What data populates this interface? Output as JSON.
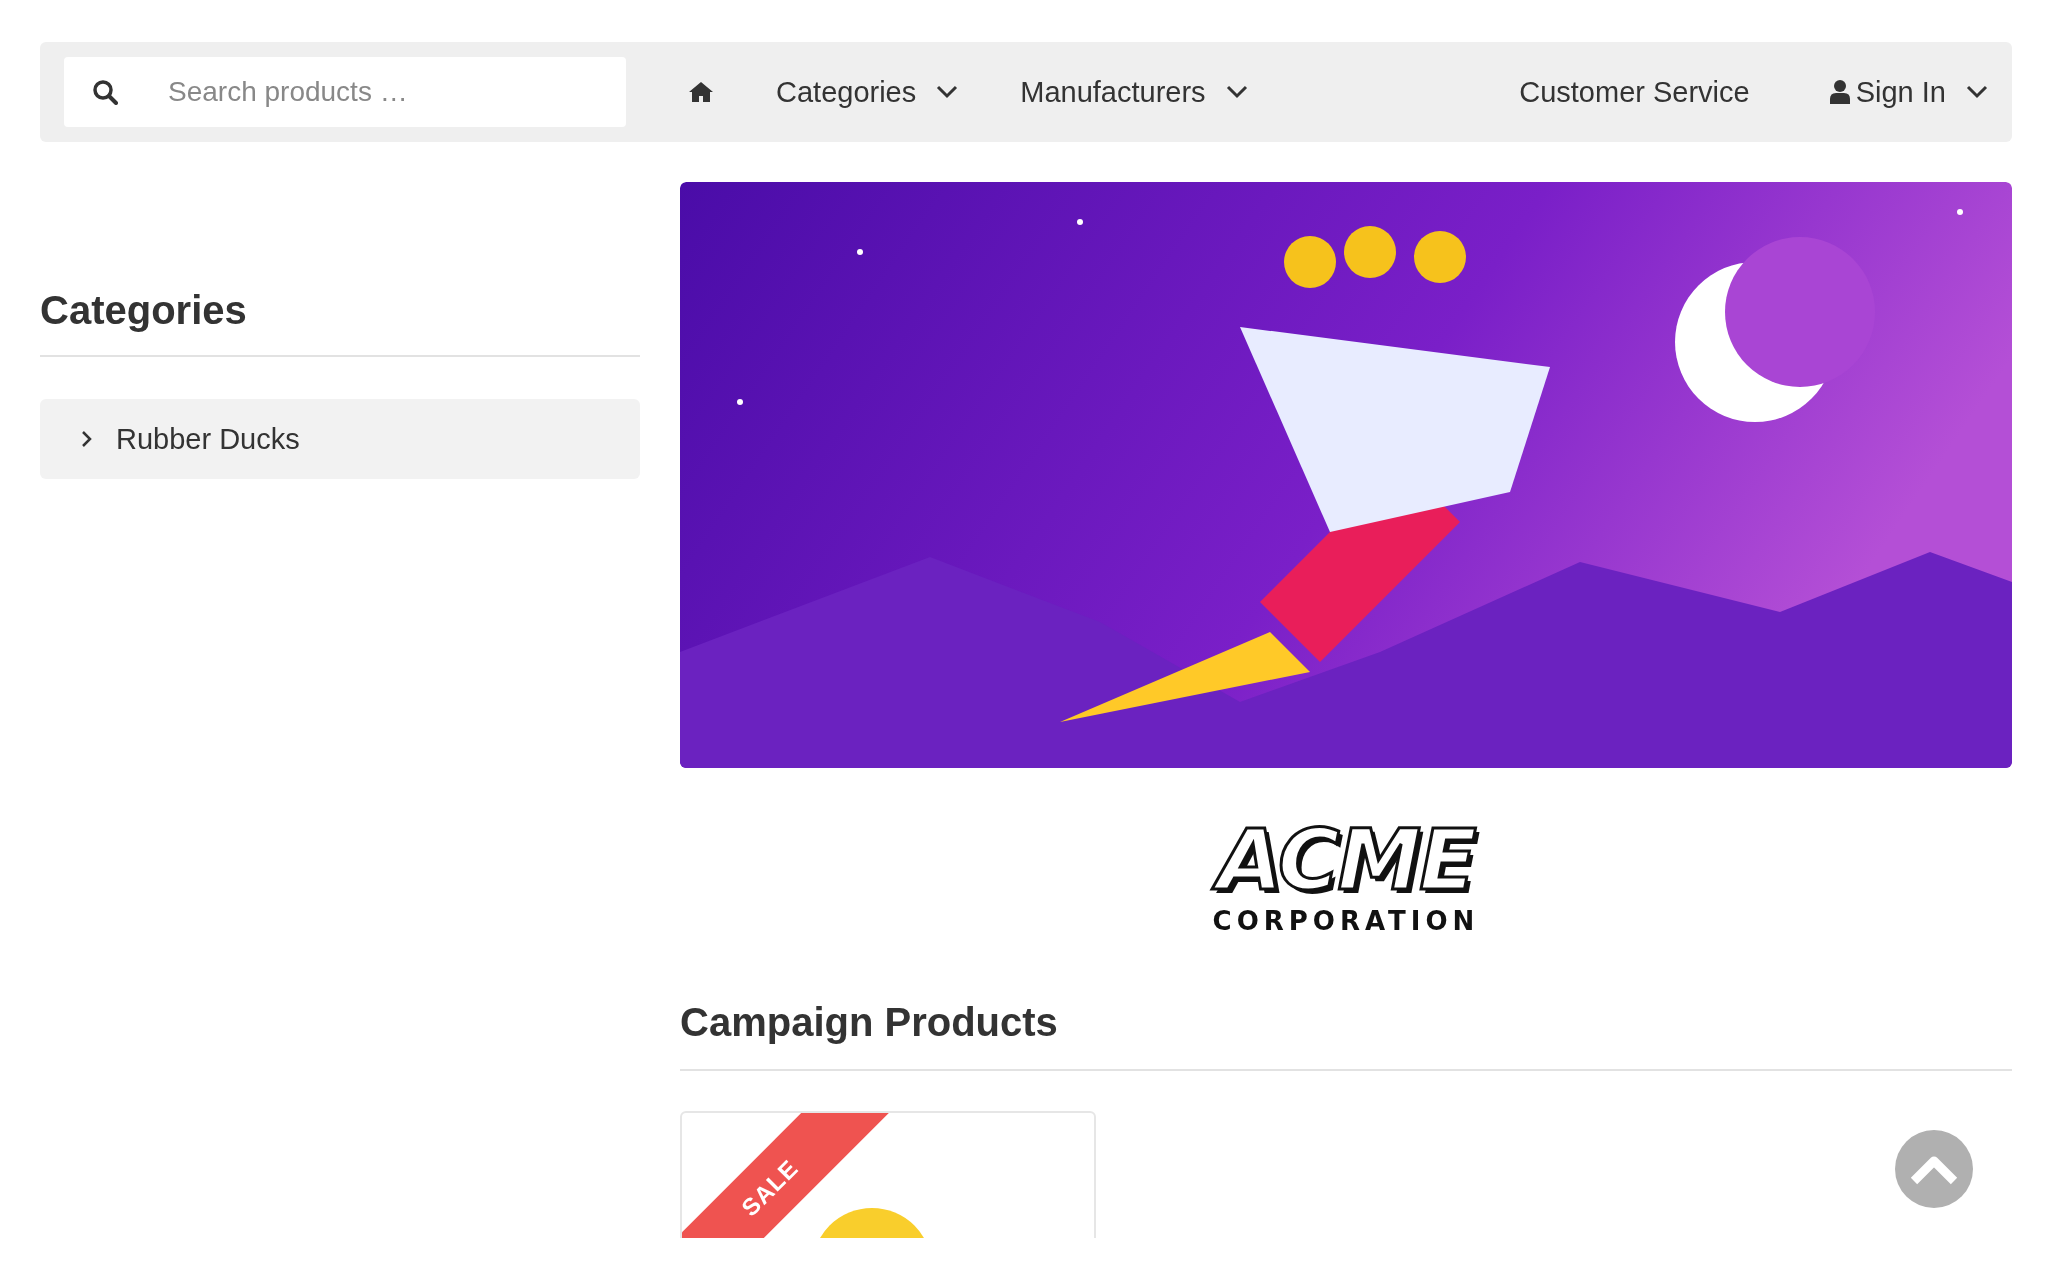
{
  "search": {
    "placeholder": "Search products …"
  },
  "nav_left": [
    {
      "kind": "home"
    },
    {
      "kind": "dropdown",
      "label": "Categories"
    },
    {
      "kind": "dropdown",
      "label": "Manufacturers"
    }
  ],
  "nav_right": [
    {
      "kind": "link",
      "label": "Customer Service"
    },
    {
      "kind": "account",
      "label": "Sign In"
    }
  ],
  "sidebar": {
    "title": "Categories",
    "items": [
      {
        "label": "Rubber Ducks",
        "expanded": false
      }
    ]
  },
  "logo": {
    "name": "ACME",
    "subtitle": "CORPORATION"
  },
  "campaign": {
    "title": "Campaign Products",
    "products": [
      {
        "badge": "SALE"
      }
    ]
  }
}
